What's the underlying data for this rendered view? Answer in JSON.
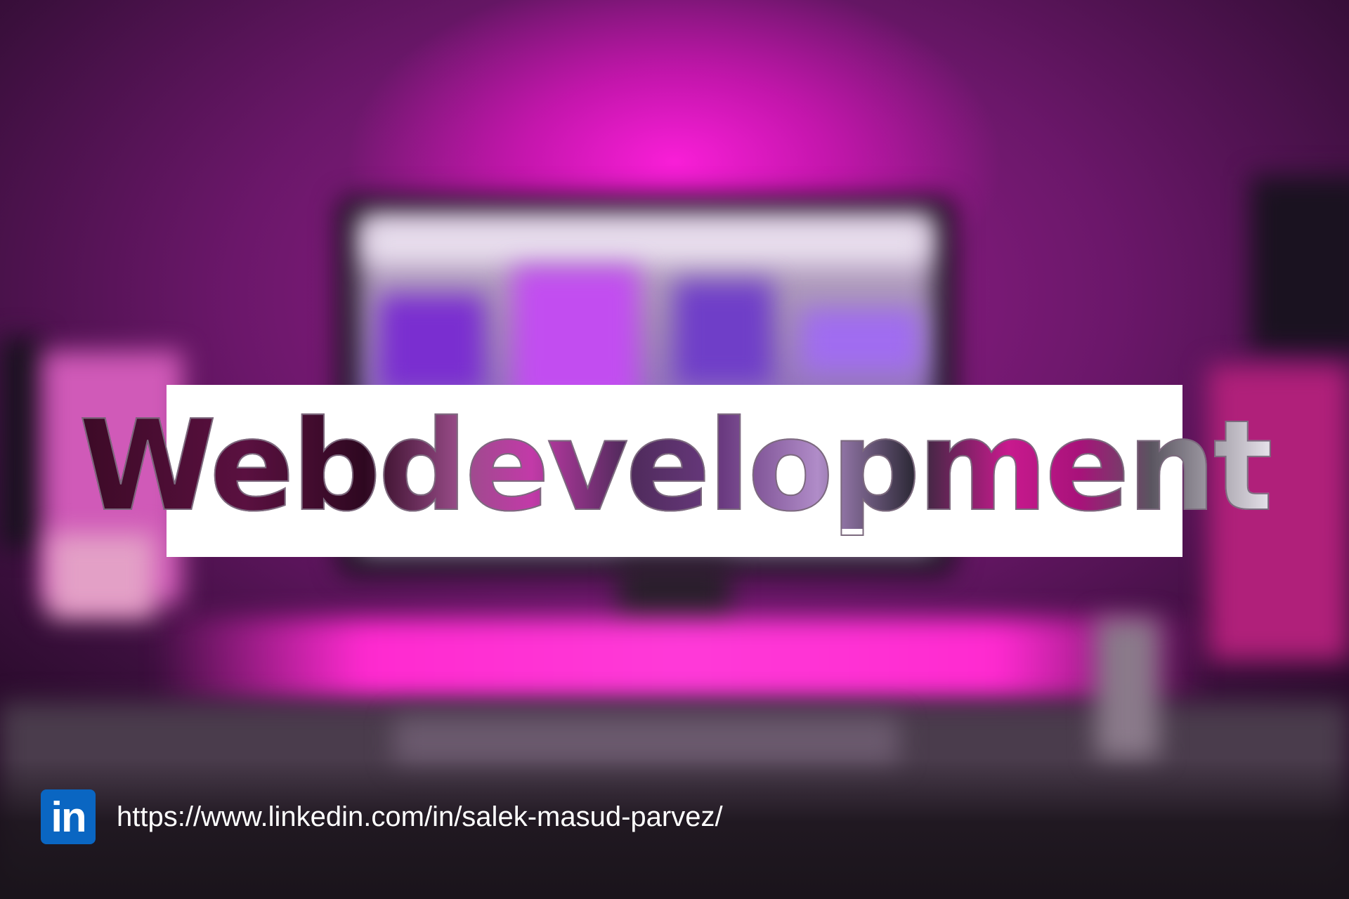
{
  "banner": {
    "title": "Webdevelopment"
  },
  "footer": {
    "icon_text": "in",
    "icon_name": "linkedin-icon",
    "url": "https://www.linkedin.com/in/salek-masud-parvez/"
  },
  "colors": {
    "background_glow": "#ff1ad8",
    "banner_background": "#ffffff",
    "linkedin_blue": "#0a66c2",
    "url_text": "#ffffff"
  }
}
